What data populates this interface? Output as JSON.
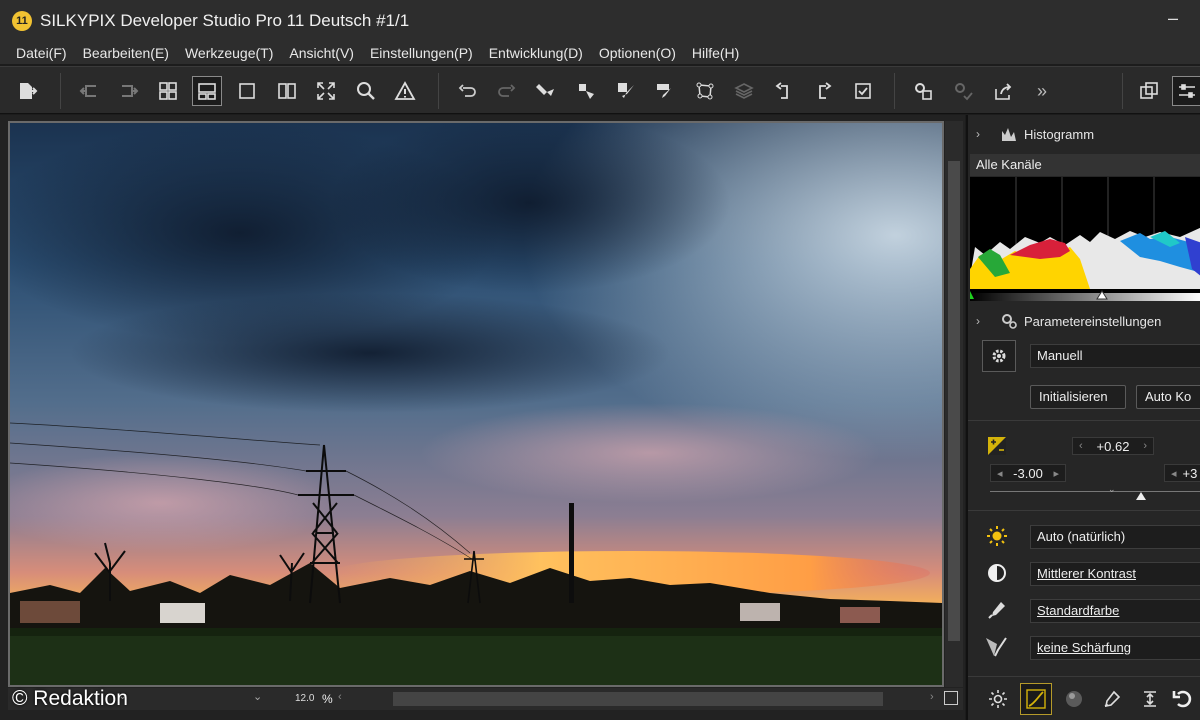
{
  "window": {
    "logo_text": "11",
    "title": "SILKYPIX Developer Studio Pro 11 Deutsch   #1/1",
    "minimize_glyph": "–"
  },
  "menu": [
    {
      "label": "Datei(F)"
    },
    {
      "label": "Bearbeiten(E)"
    },
    {
      "label": "Werkzeuge(T)"
    },
    {
      "label": "Ansicht(V)"
    },
    {
      "label": "Einstellungen(P)"
    },
    {
      "label": "Entwicklung(D)"
    },
    {
      "label": "Optionen(O)"
    },
    {
      "label": "Hilfe(H)"
    }
  ],
  "toolbar": {
    "icons": [
      "export-icon",
      "prev-photo-icon",
      "next-photo-icon",
      "thumbnail-view-icon",
      "filmstrip-view-icon",
      "single-view-icon",
      "compare-view-icon",
      "fullscreen-icon",
      "zoom-icon",
      "warning-icon",
      "undo-icon",
      "redo-icon",
      "copy-develop-icon",
      "paste-develop-icon",
      "brush-icon",
      "stamp-icon",
      "crop-points-icon",
      "layers-icon",
      "rotate-left-icon",
      "rotate-right-icon",
      "mark-check-icon",
      "batch-develop-icon",
      "develop-settings-icon",
      "share-icon",
      "more-icon",
      "window-icon",
      "sliders-icon"
    ],
    "active": "filmstrip-view-icon",
    "more_glyph": "»"
  },
  "viewer": {
    "zoom_value": "12.0",
    "zoom_unit": "%",
    "watermark": "© Redaktion"
  },
  "panel": {
    "histogram": {
      "title": "Histogramm",
      "channel": "Alle Kanäle"
    },
    "params": {
      "title": "Parametereinstellungen",
      "preset": "Manuell",
      "init_button": "Initialisieren",
      "auto_button": "Auto Ko"
    },
    "exposure": {
      "value": "+0.62",
      "left_value": "-3.00",
      "right_value": "+3"
    },
    "rows": [
      {
        "icon": "white-balance-icon",
        "value": "Auto (natürlich)",
        "link": false
      },
      {
        "icon": "contrast-icon",
        "value": "Mittlerer Kontrast",
        "link": true
      },
      {
        "icon": "color-dropper-icon",
        "value": "Standardfarbe",
        "link": true
      },
      {
        "icon": "sharpness-icon",
        "value": "keine Schärfung",
        "link": true
      }
    ],
    "bottom_tools": [
      "exposure-bias-icon",
      "tone-curve-icon",
      "sphere-icon",
      "fine-color-icon",
      "lens-correction-icon",
      "reset-icon"
    ],
    "bottom_active": "tone-curve-icon"
  },
  "colors": {
    "accent": "#f1c232",
    "panel_bg": "#262626",
    "toolbar_bg": "#2a2a2a"
  }
}
